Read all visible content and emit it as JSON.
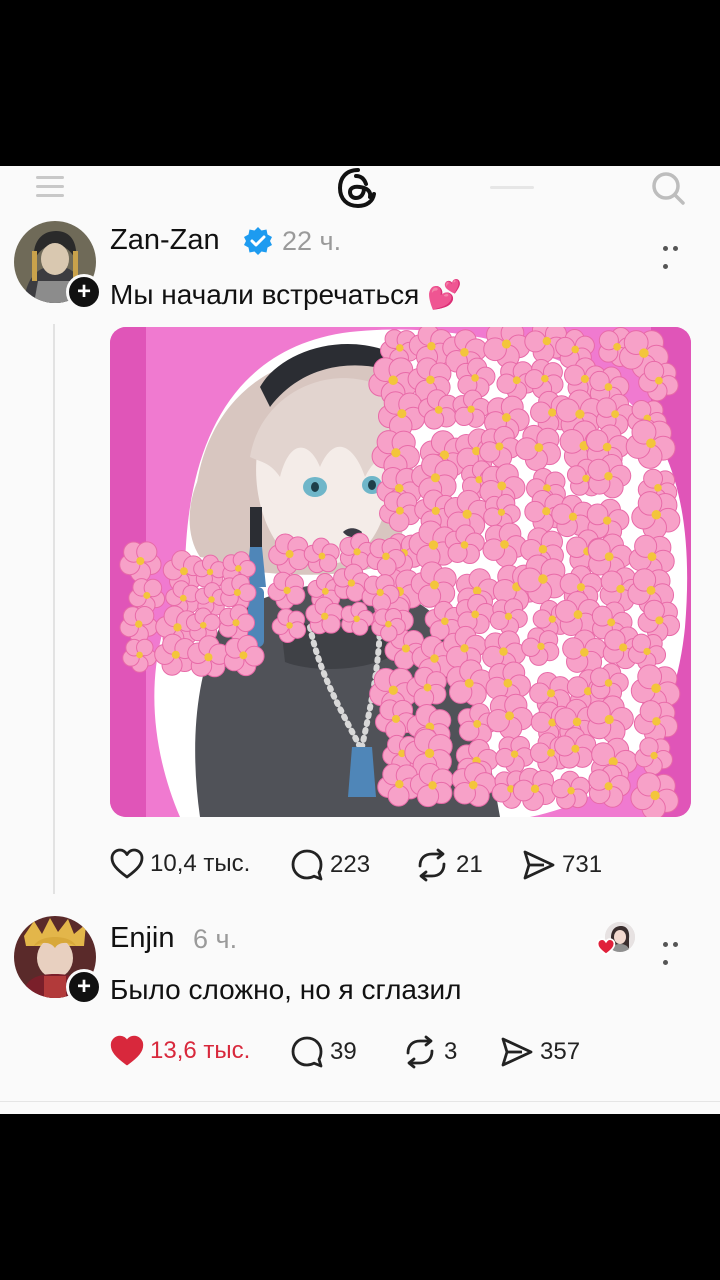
{
  "post": {
    "username": "Zan-Zan",
    "verified": true,
    "time": "22 ч.",
    "text": "Мы начали встречаться",
    "emoji": "💕",
    "likes": "10,4 тыс.",
    "replies": "223",
    "reposts": "21",
    "shares": "731"
  },
  "reply": {
    "username": "Enjin",
    "time": "6 ч.",
    "text": "Было сложно, но я сглазил",
    "likes": "13,6 тыс.",
    "liked": true,
    "replies": "39",
    "reposts": "3",
    "shares": "357"
  },
  "colors": {
    "like_red": "#d8283c",
    "verified_blue": "#1d9bf0",
    "image_magenta": "#e055b8",
    "flower_pink": "#f7a1c8"
  }
}
